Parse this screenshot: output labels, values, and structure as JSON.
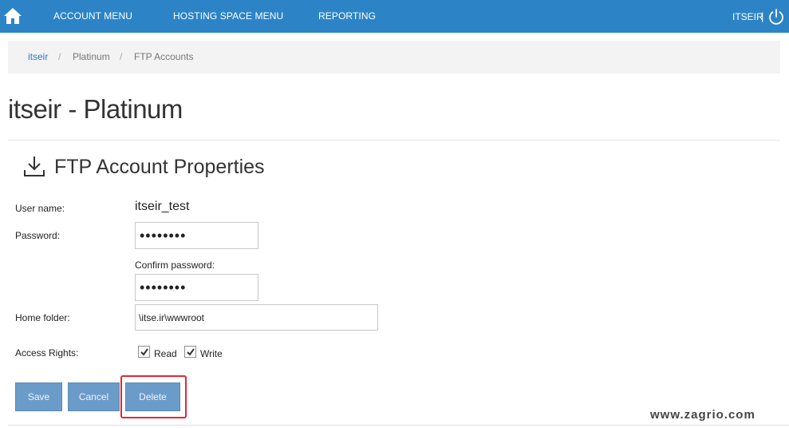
{
  "navbar": {
    "menu_items": [
      "ACCOUNT MENU",
      "HOSTING SPACE MENU",
      "REPORTING"
    ],
    "user": "ITSEIR",
    "separator": "|",
    "home_icon": "home-icon",
    "power_icon": "power-icon",
    "color": "#2c84c6"
  },
  "breadcrumb": {
    "items": [
      "itseir",
      "Platinum",
      "FTP Accounts"
    ],
    "separator": "/"
  },
  "page": {
    "title": "itseir - Platinum"
  },
  "section": {
    "title": "FTP Account Properties",
    "icon": "download-icon"
  },
  "form": {
    "username_label": "User name:",
    "username_value": "itseir_test",
    "password_label": "Password:",
    "password_value": "pass1234",
    "confirm_label": "Confirm password:",
    "confirm_value": "pass1234",
    "home_label": "Home folder:",
    "home_value": "\\itse.ir\\wwwroot",
    "access_label": "Access Rights:",
    "read_label": "Read",
    "read_checked": true,
    "write_label": "Write",
    "write_checked": true
  },
  "buttons": {
    "save": "Save",
    "cancel": "Cancel",
    "delete": "Delete",
    "color": "#6b9bc8",
    "highlight_color": "#e0283a"
  },
  "watermark": "www.zagrio.com"
}
